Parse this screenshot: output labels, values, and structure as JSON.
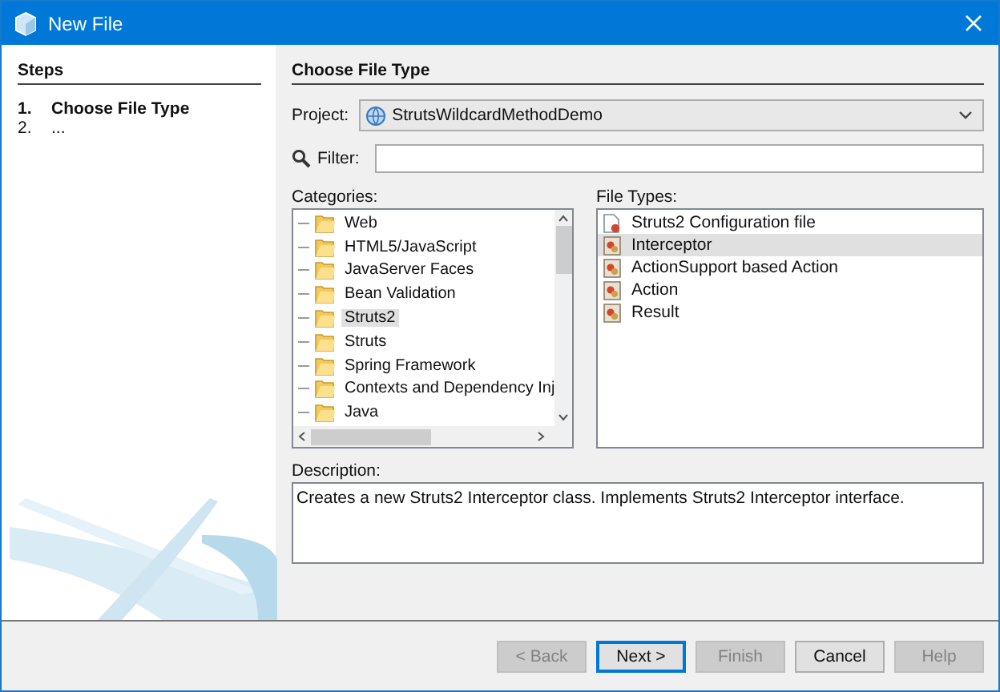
{
  "window": {
    "title": "New File"
  },
  "steps": {
    "title": "Steps",
    "items": [
      {
        "number": "1.",
        "label": "Choose File Type",
        "selected": true
      },
      {
        "number": "2.",
        "label": "...",
        "selected": false
      }
    ]
  },
  "panel": {
    "title": "Choose File Type"
  },
  "project": {
    "label": "Project:",
    "value": "StrutsWildcardMethodDemo"
  },
  "filter": {
    "label": "Filter:"
  },
  "categories": {
    "label": "Categories:",
    "items": [
      {
        "label": "Web",
        "selected": false
      },
      {
        "label": "HTML5/JavaScript",
        "selected": false
      },
      {
        "label": "JavaServer Faces",
        "selected": false
      },
      {
        "label": "Bean Validation",
        "selected": false
      },
      {
        "label": "Struts2",
        "selected": true
      },
      {
        "label": "Struts",
        "selected": false
      },
      {
        "label": "Spring Framework",
        "selected": false
      },
      {
        "label": "Contexts and Dependency Inj",
        "selected": false
      },
      {
        "label": "Java",
        "selected": false
      }
    ]
  },
  "file_types": {
    "label": "File Types:",
    "items": [
      {
        "label": "Struts2 Configuration file",
        "kind": "config",
        "selected": false
      },
      {
        "label": "Interceptor",
        "kind": "action",
        "selected": true
      },
      {
        "label": "ActionSupport based Action",
        "kind": "action",
        "selected": false
      },
      {
        "label": "Action",
        "kind": "action",
        "selected": false
      },
      {
        "label": "Result",
        "kind": "action",
        "selected": false
      }
    ]
  },
  "description": {
    "label": "Description:",
    "text": "Creates a new Struts2 Interceptor class. Implements Struts2 Interceptor interface."
  },
  "buttons": [
    {
      "label": "< Back",
      "disabled": true,
      "default": false
    },
    {
      "label": "Next >",
      "disabled": false,
      "default": true
    },
    {
      "label": "Finish",
      "disabled": true,
      "default": false
    },
    {
      "label": "Cancel",
      "disabled": false,
      "default": false
    },
    {
      "label": "Help",
      "disabled": true,
      "default": false
    }
  ]
}
